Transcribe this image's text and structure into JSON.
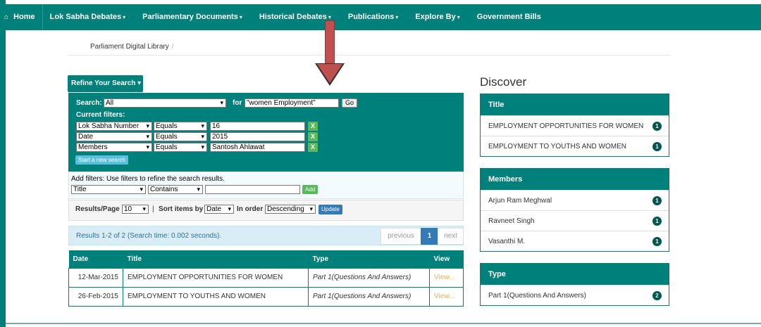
{
  "nav": {
    "home": "Home",
    "items": [
      "Lok Sabha Debates",
      "Parliamentary Documents",
      "Historical Debates",
      "Publications",
      "Explore By",
      "Government Bills"
    ]
  },
  "breadcrumb": {
    "label": "Parliament Digital Library",
    "sep": "/"
  },
  "refine": {
    "label": "Refine Your Search ▾"
  },
  "search": {
    "label": "Search:",
    "scope": "All",
    "for_label": "for",
    "query": "\"women Employment\"",
    "go": "Go",
    "current_filters_label": "Current filters:",
    "filters": [
      {
        "field": "Lok Sabha Number",
        "op": "Equals",
        "value": "16"
      },
      {
        "field": "Date",
        "op": "Equals",
        "value": "2015"
      },
      {
        "field": "Members",
        "op": "Equals",
        "value": "Santosh Ahlawat"
      }
    ],
    "remove": "X",
    "new_search": "Start a new search"
  },
  "add_filters": {
    "label": "Add filters: Use filters to refine the search results.",
    "field": "Title",
    "op": "Contains",
    "value": "",
    "button": "Add"
  },
  "results_options": {
    "per_page_label": "Results/Page",
    "per_page": "10",
    "sep": "|",
    "sort_label": "Sort items by",
    "sort_by": "Date",
    "order_label": "In order",
    "order": "Descending",
    "update": "Update"
  },
  "summary": {
    "text": "Results 1-2 of 2 (Search time: 0.002 seconds).",
    "previous": "previous",
    "page": "1",
    "next": "next"
  },
  "table": {
    "headers": [
      "Date",
      "Title",
      "Type",
      "View"
    ],
    "rows": [
      {
        "date": "12-Mar-2015",
        "title": "EMPLOYMENT OPPORTUNITIES FOR WOMEN",
        "type": "Part 1(Questions And Answers)",
        "view": "View..."
      },
      {
        "date": "26-Feb-2015",
        "title": "EMPLOYMENT TO YOUTHS AND WOMEN",
        "type": "Part 1(Questions And Answers)",
        "view": "View..."
      }
    ]
  },
  "discover": {
    "title": "Discover",
    "panels": [
      {
        "head": "Title",
        "items": [
          {
            "label": "EMPLOYMENT OPPORTUNITIES FOR WOMEN",
            "count": "1"
          },
          {
            "label": "EMPLOYMENT TO YOUTHS AND WOMEN",
            "count": "1"
          }
        ]
      },
      {
        "head": "Members",
        "items": [
          {
            "label": "Arjun Ram Meghwal",
            "count": "1"
          },
          {
            "label": "Ravneet Singh",
            "count": "1"
          },
          {
            "label": "Vasanthi M.",
            "count": "1"
          }
        ]
      },
      {
        "head": "Type",
        "items": [
          {
            "label": "Part 1(Questions And Answers)",
            "count": "2"
          }
        ]
      }
    ]
  },
  "colors": {
    "brand": "#00807a",
    "arrow": "#c0504d"
  }
}
